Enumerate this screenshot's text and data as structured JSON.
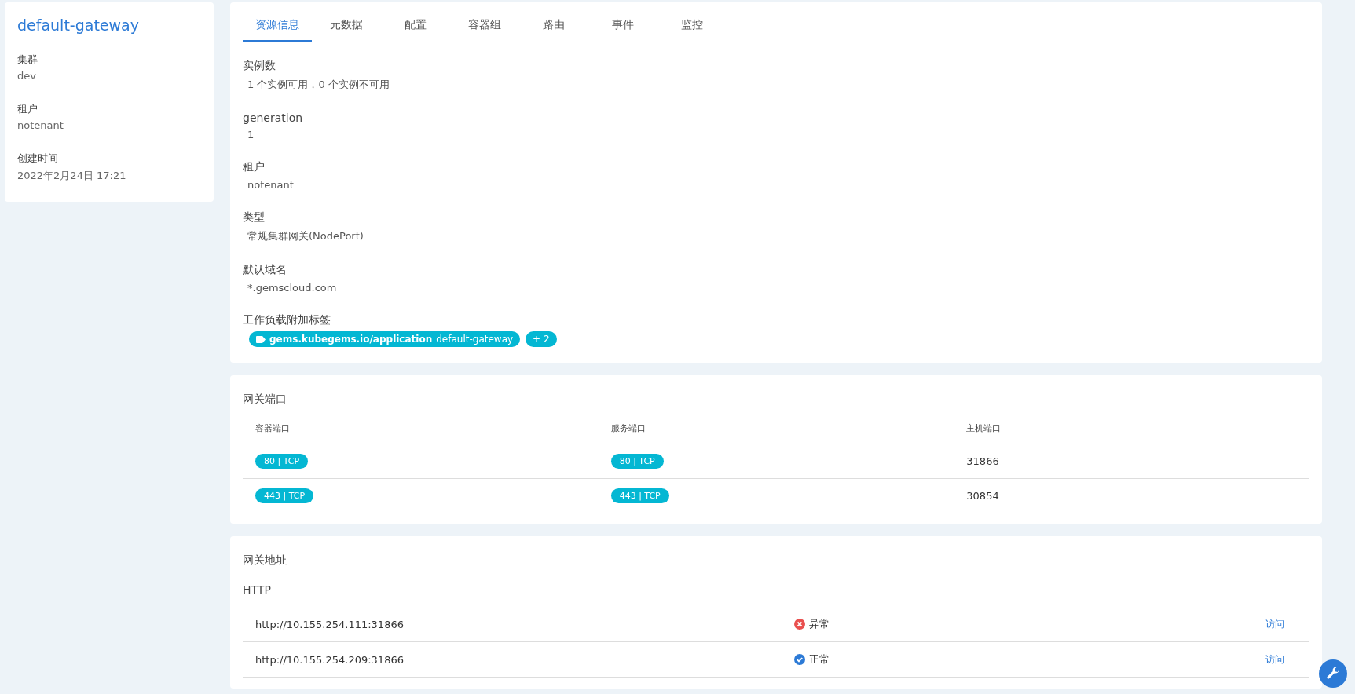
{
  "sidebar": {
    "title": "default-gateway",
    "fields": [
      {
        "label": "集群",
        "value": "dev"
      },
      {
        "label": "租户",
        "value": "notenant"
      },
      {
        "label": "创建时间",
        "value": "2022年2月24日 17:21"
      }
    ]
  },
  "tabs": [
    {
      "label": "资源信息",
      "selected": true
    },
    {
      "label": "元数据",
      "selected": false
    },
    {
      "label": "配置",
      "selected": false
    },
    {
      "label": "容器组",
      "selected": false
    },
    {
      "label": "路由",
      "selected": false
    },
    {
      "label": "事件",
      "selected": false
    },
    {
      "label": "监控",
      "selected": false
    }
  ],
  "info": [
    {
      "label": "实例数",
      "value": "1 个实例可用，0 个实例不可用"
    },
    {
      "label": "generation",
      "value": "1"
    },
    {
      "label": "租户",
      "value": "notenant"
    },
    {
      "label": "类型",
      "value": "常规集群网关(NodePort)"
    },
    {
      "label": "默认域名",
      "value": "*.gemscloud.com"
    }
  ],
  "labels": {
    "title": "工作负载附加标签",
    "tag_key": "gems.kubegems.io/application",
    "tag_value": "default-gateway",
    "more": "+ 2"
  },
  "ports": {
    "title": "网关端口",
    "columns": [
      "容器端口",
      "服务端口",
      "主机端口"
    ],
    "rows": [
      [
        "80 | TCP",
        "80 | TCP",
        "31866"
      ],
      [
        "443 | TCP",
        "443 | TCP",
        "30854"
      ]
    ]
  },
  "addresses": {
    "title": "网关地址",
    "protocol": "HTTP",
    "rows": [
      {
        "url": "http://10.155.254.111:31866",
        "kind": "error",
        "status_text": "异常",
        "action": "访问"
      },
      {
        "url": "http://10.155.254.209:31866",
        "kind": "ok",
        "status_text": "正常",
        "action": "访问"
      }
    ]
  }
}
